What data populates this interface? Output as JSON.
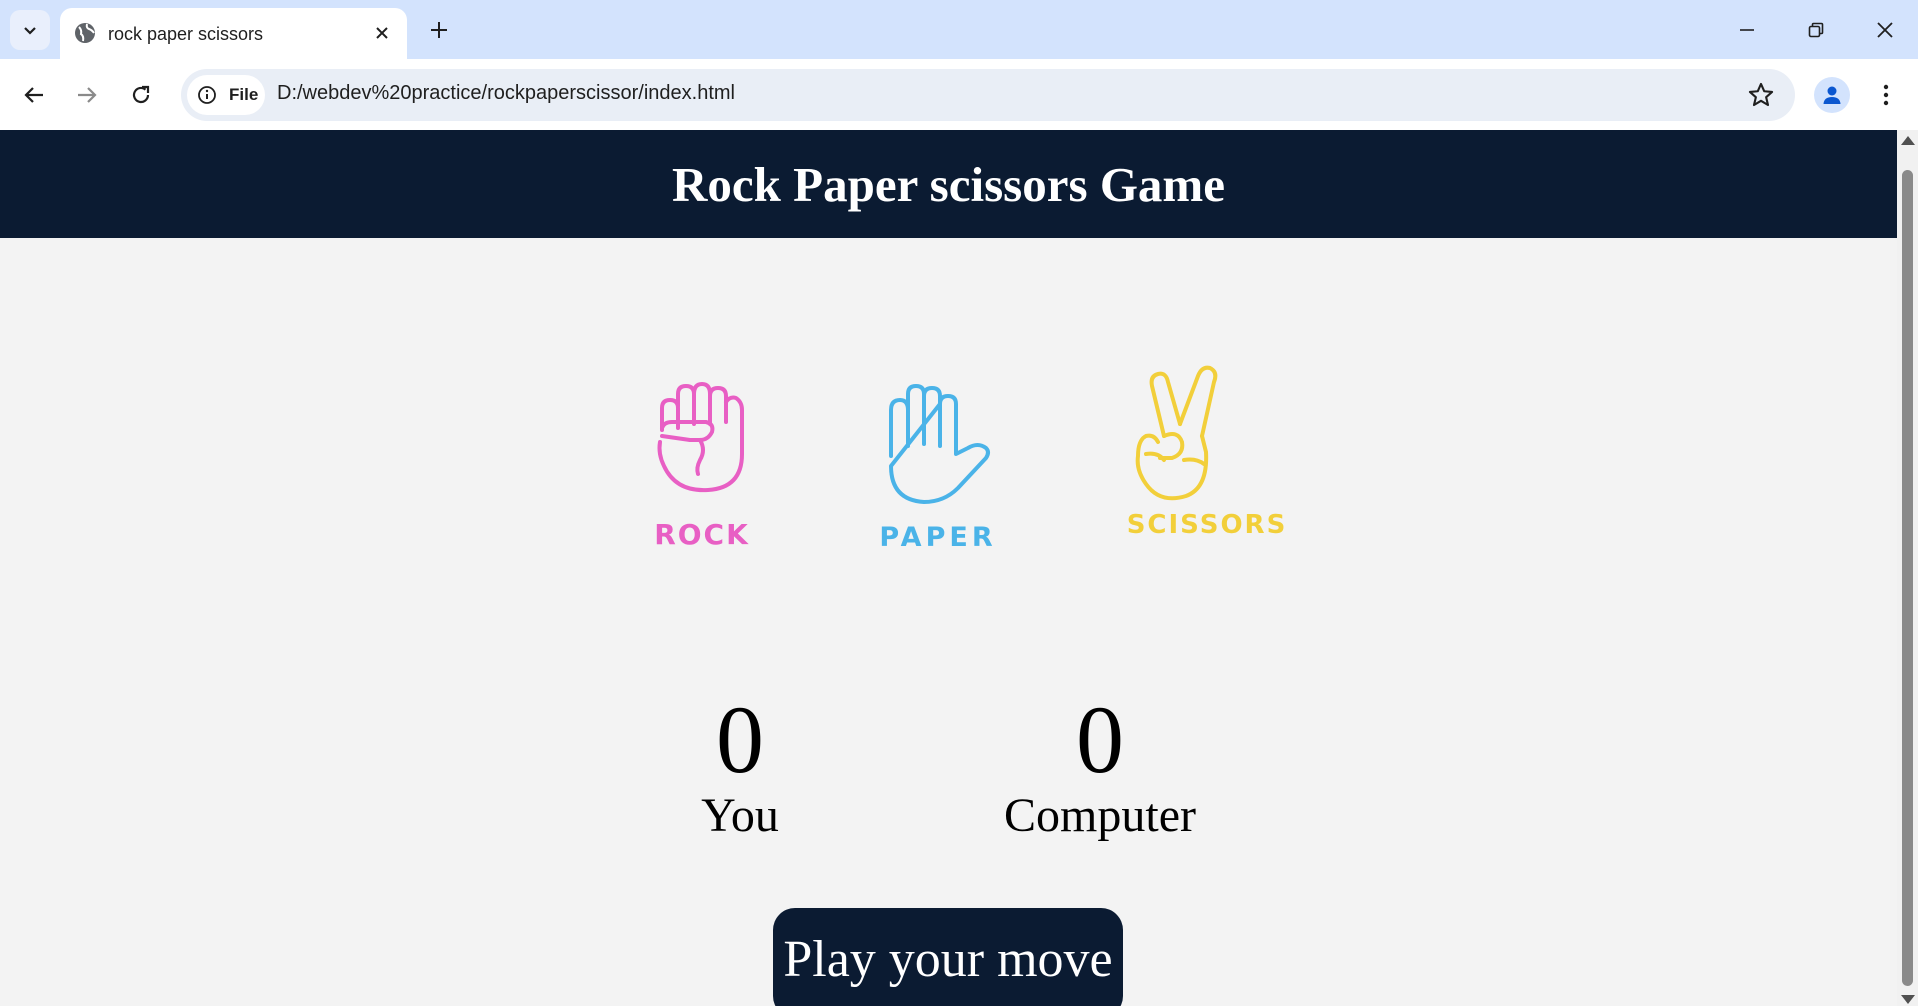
{
  "browser": {
    "tab_title": "rock paper scissors",
    "chip_label": "File",
    "url": "D:/webdev%20practice/rockpaperscissor/index.html"
  },
  "page": {
    "title": "Rock Paper scissors Game",
    "choices": [
      {
        "id": "rock",
        "label": "ROCK",
        "color": "#e85fc4"
      },
      {
        "id": "paper",
        "label": "PAPER",
        "color": "#4ab3e8"
      },
      {
        "id": "scissors",
        "label": "SCISSORS",
        "color": "#f2cf3a"
      }
    ],
    "scores": {
      "user_score": "0",
      "user_label": "You",
      "computer_score": "0",
      "computer_label": "Computer"
    },
    "play_button": "Play your move"
  },
  "colors": {
    "header_bg": "#0b1b32",
    "page_bg": "#f3f3f3",
    "tabstrip_bg": "#d3e3fd"
  }
}
